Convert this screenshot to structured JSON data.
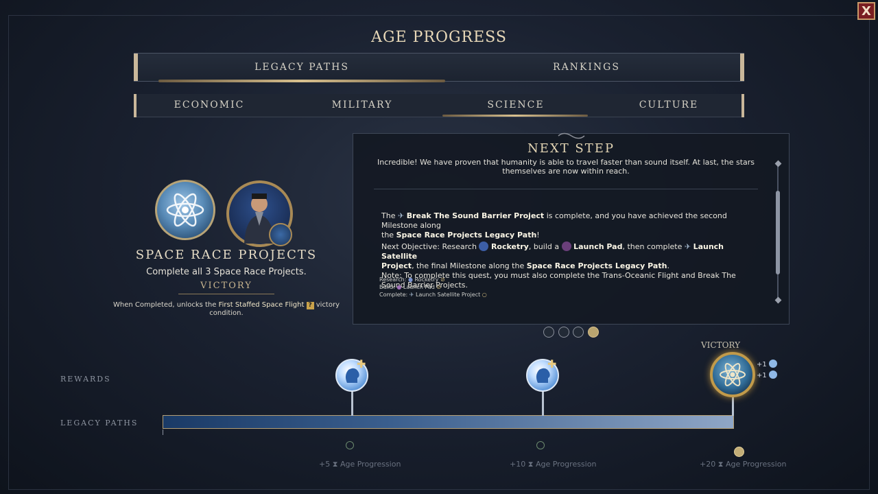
{
  "close_label": "X",
  "title": "AGE PROGRESS",
  "tabs": [
    {
      "label": "LEGACY PATHS",
      "active": true
    },
    {
      "label": "RANKINGS",
      "active": false
    }
  ],
  "subtabs": [
    {
      "label": "ECONOMIC"
    },
    {
      "label": "MILITARY"
    },
    {
      "label": "SCIENCE",
      "active": true
    },
    {
      "label": "CULTURE"
    }
  ],
  "legacy": {
    "name": "SPACE RACE PROJECTS",
    "description": "Complete all 3 Space Race Projects.",
    "victory_label": "VICTORY",
    "note_prefix": "When Completed, unlocks the ",
    "note_highlight": "First Staffed Space Flight",
    "note_badge": "?",
    "note_suffix": " victory condition."
  },
  "next_step": {
    "title": "NEXT STEP",
    "quote_line1": "Incredible! We have proven that humanity is able to travel faster than sound itself. At last, the stars",
    "quote_line2": "themselves are now within reach.",
    "p1_a": "The ",
    "p1_b": "Break The Sound Barrier Project",
    "p1_c": " is complete, and you have achieved the second Milestone along",
    "p1_d": "the ",
    "p1_e": "Space Race Projects Legacy Path",
    "p1_f": "!",
    "p2_a": "Next Objective: Research ",
    "p2_b": "Rocketry",
    "p2_c": ", build a ",
    "p2_d": "Launch Pad",
    "p2_e": ", then complete ",
    "p2_f": "Launch Satellite",
    "p2_g": "Project",
    "p2_h": ", the final Milestone along the ",
    "p2_i": "Space Race Projects Legacy Path",
    "p2_j": ".",
    "p3": "Note: To complete this quest, you must also complete the Trans-Oceanic Flight and Break The Sound Barrier Projects.",
    "requirements": [
      {
        "label": "Research:",
        "item": "Rocketry",
        "done": true
      },
      {
        "label": "Build:",
        "item": "Launch Pad",
        "done": true
      },
      {
        "label": "Complete:",
        "item": "Launch Satellite Project",
        "done": false
      }
    ]
  },
  "pager": {
    "count": 4,
    "active_index": 3
  },
  "timeline": {
    "rewards_label": "REWARDS",
    "paths_label": "LEGACY PATHS",
    "victory_label": "VICTORY",
    "victory_rewards": [
      "+1",
      "+1"
    ],
    "progress_fraction": 1.0,
    "milestones": [
      {
        "points": "+5",
        "label": "Age Progression",
        "reached": true
      },
      {
        "points": "+10",
        "label": "Age Progression",
        "reached": true
      },
      {
        "points": "+20",
        "label": "Age Progression",
        "reached": false
      }
    ]
  },
  "colors": {
    "accent_gold": "#d8c08e",
    "bar_blue": "#3b5f8e",
    "close_red": "#7a1e22"
  }
}
